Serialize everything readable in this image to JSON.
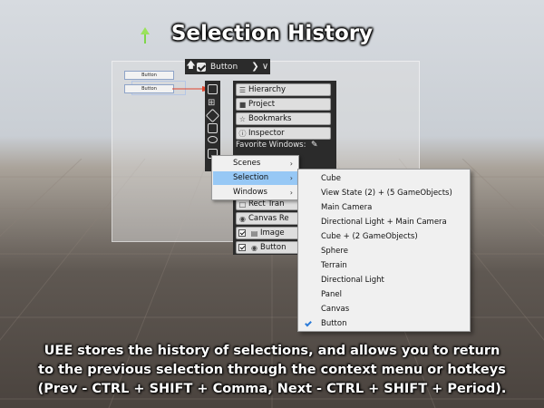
{
  "title": "Selection History",
  "toolbar": {
    "label": "Button"
  },
  "scene_buttons": [
    "Button",
    "Button"
  ],
  "panel": {
    "buttons": [
      "Hierarchy",
      "Project",
      "Bookmarks",
      "Inspector"
    ],
    "favorites_label": "Favorite Windows:",
    "components": [
      "Rect Tran",
      "Canvas Re",
      "Image",
      "Button"
    ]
  },
  "context_menu": {
    "items": [
      "Scenes",
      "Selection",
      "Windows"
    ],
    "highlighted": "Selection"
  },
  "submenu": {
    "items": [
      "Cube",
      "View State (2) + (5 GameObjects)",
      "Main Camera",
      "Directional Light + Main Camera",
      "Cube + (2 GameObjects)",
      "Sphere",
      "Terrain",
      "Directional Light",
      "Panel",
      "Canvas",
      "Button"
    ],
    "checked": "Button"
  },
  "caption": {
    "line1": "UEE stores the history of selections, and allows you to return",
    "line2": "to the previous selection through the context menu or hotkeys",
    "line3": "(Prev - CTRL + SHIFT + Comma, Next - CTRL + SHIFT + Period)."
  },
  "colors": {
    "highlight": "#97c8f5",
    "panel": "#2b2b2b",
    "check": "#2a7ad8",
    "arrow": "#e0442c"
  },
  "icons": [
    "move-gizmo-icon",
    "arrow-up-icon",
    "checkbox-icon",
    "chevron-right-icon",
    "chevron-down-icon",
    "select-icon",
    "hierarchy-icon",
    "tag-icon",
    "copy-icon",
    "eye-icon",
    "folder-icon",
    "star-icon",
    "info-icon",
    "pencil-icon",
    "checkmark-icon"
  ]
}
